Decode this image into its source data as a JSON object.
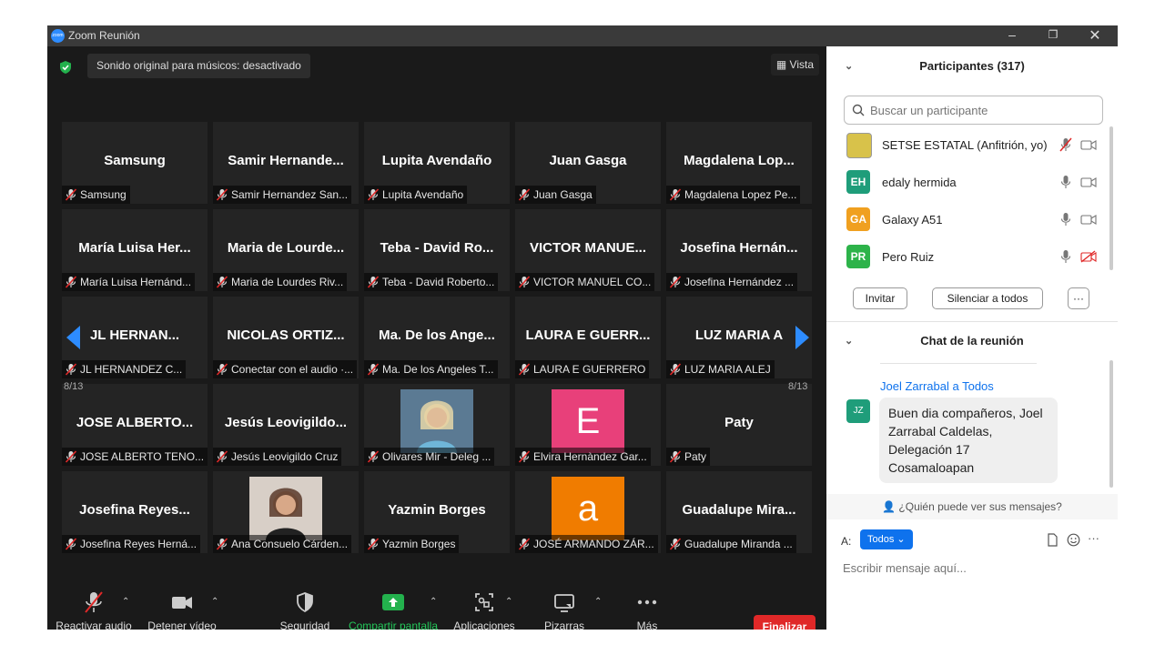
{
  "window": {
    "title": "Zoom Reunión",
    "logo_text": "zoom"
  },
  "video": {
    "audio_banner": "Sonido original para músicos: desactivado",
    "view_button": "Vista",
    "page_left": "8/13",
    "page_right": "8/13",
    "tiles": [
      {
        "name": "Samsung",
        "label": "Samsung"
      },
      {
        "name": "Samir  Hernande...",
        "label": "Samir Hernandez San..."
      },
      {
        "name": "Lupita Avendaño",
        "label": "Lupita Avendaño"
      },
      {
        "name": "Juan Gasga",
        "label": "Juan Gasga"
      },
      {
        "name": "Magdalena  Lop...",
        "label": "Magdalena Lopez Pe..."
      },
      {
        "name": "María Luisa Her...",
        "label": "María Luisa Hernánd..."
      },
      {
        "name": "Maria de Lourde...",
        "label": "Maria de Lourdes Riv..."
      },
      {
        "name": "Teba - David Ro...",
        "label": "Teba - David Roberto..."
      },
      {
        "name": "VICTOR  MANUE...",
        "label": "VICTOR MANUEL CO..."
      },
      {
        "name": "Josefina  Hernán...",
        "label": "Josefina Hernández ..."
      },
      {
        "name": "JL HERNAN...",
        "label": "JL HERNANDEZ C..."
      },
      {
        "name": "NICOLAS  ORTIZ...",
        "label": "Conectar con el audio ·..."
      },
      {
        "name": "Ma. De los Ange...",
        "label": "Ma. De los Angeles T..."
      },
      {
        "name": "LAURA E GUERR...",
        "label": "LAURA E GUERRERO"
      },
      {
        "name": "LUZ MARIA A",
        "label": "LUZ MARIA ALEJ"
      },
      {
        "name": "JOSE ALBERTO...",
        "label": "JOSE ALBERTO TENO..."
      },
      {
        "name": "Jesús  Leovigildo...",
        "label": "Jesús Leovigildo Cruz"
      },
      {
        "name": "",
        "label": "Olivares Mir - Deleg ..."
      },
      {
        "name": "",
        "label": "Elvira Hernàndez Gar...",
        "avatar_letter": "E",
        "avatar_color": "#e8407a"
      },
      {
        "name": "Paty",
        "label": "Paty"
      },
      {
        "name": "Josefina Reyes...",
        "label": "Josefina Reyes Herná..."
      },
      {
        "name": "",
        "label": "Ana Consuelo Cárden..."
      },
      {
        "name": "Yazmin Borges",
        "label": "Yazmin Borges"
      },
      {
        "name": "",
        "label": "JOSÉ ARMANDO ZÁR...",
        "avatar_letter": "a",
        "avatar_color": "#f07c00"
      },
      {
        "name": "Guadalupe  Mira...",
        "label": "Guadalupe Miranda ..."
      }
    ]
  },
  "toolbar": {
    "unmute": "Reactivar audio",
    "stop_video": "Detener vídeo",
    "security": "Seguridad",
    "share": "Compartir pantalla",
    "apps": "Aplicaciones",
    "boards": "Pizarras",
    "more": "Más",
    "end": "Finalizar"
  },
  "participants": {
    "header": "Participantes (317)",
    "search_placeholder": "Buscar un participante",
    "list": [
      {
        "initials": "",
        "name": "SETSE ESTATAL (Anfitrión, yo)",
        "color": "#d8c24a"
      },
      {
        "initials": "EH",
        "name": "edaly hermida",
        "color": "#1f9d7a"
      },
      {
        "initials": "GA",
        "name": "Galaxy A51",
        "color": "#f0a020"
      },
      {
        "initials": "PR",
        "name": "Pero Ruiz",
        "color": "#2db34a"
      }
    ],
    "invite": "Invitar",
    "mute_all": "Silenciar a todos",
    "more": "···"
  },
  "chat": {
    "header": "Chat de la reunión",
    "sender": "Joel Zarrabal a Todos",
    "sender_initials": "JZ",
    "message": "Buen dia compañeros, Joel Zarrabal Caldelas, Delegación 17 Cosamaloapan",
    "who_can_see": "¿Quién puede ver sus mensajes?",
    "to_label": "A:",
    "to_value": "Todos",
    "input_placeholder": "Escribir mensaje aquí...",
    "more": "···"
  }
}
